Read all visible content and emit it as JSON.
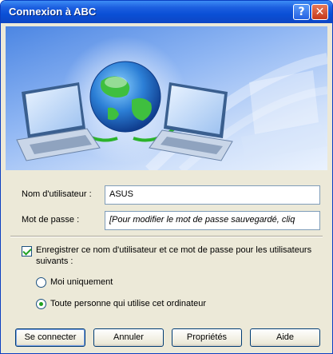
{
  "window": {
    "title": "Connexion à ABC"
  },
  "titlebar": {
    "help_glyph": "?",
    "close_glyph": "✕"
  },
  "banner": {
    "icon": "network-globe-laptops-illustration"
  },
  "form": {
    "username_label": "Nom d'utilisateur :",
    "username_value": "ASUS",
    "password_label": "Mot de passe :",
    "password_value": "[Pour modifier le mot de passe sauvegardé, cliq"
  },
  "save": {
    "checked": true,
    "label": "Enregistrer ce nom d'utilisateur et ce mot de passe pour les utilisateurs suivants :",
    "options": [
      {
        "label": "Moi uniquement",
        "selected": false
      },
      {
        "label": "Toute personne qui utilise cet ordinateur",
        "selected": true
      }
    ]
  },
  "buttons": {
    "connect": "Se connecter",
    "cancel": "Annuler",
    "properties": "Propriétés",
    "help": "Aide"
  },
  "colors": {
    "title_bar": "#0a4fd6",
    "dialog_bg": "#ece9d8",
    "accent_green": "#21a121"
  }
}
